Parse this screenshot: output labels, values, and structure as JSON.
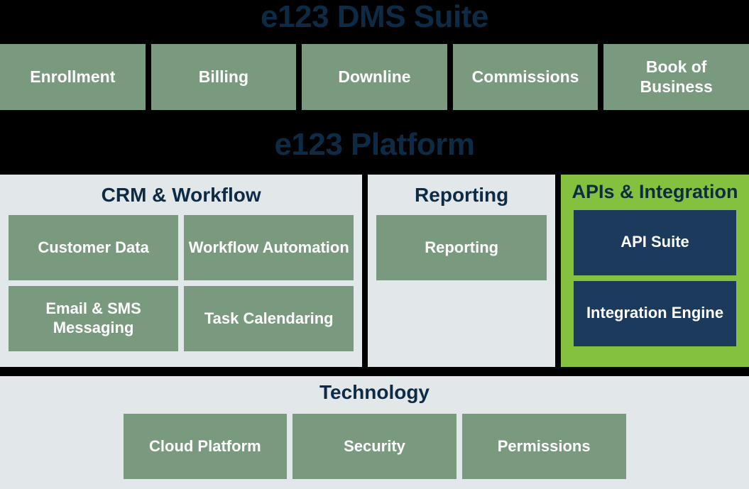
{
  "colors": {
    "background": "#000000",
    "green_tile": "#7a9a80",
    "panel_gray": "#e2e8e9",
    "accent_lime": "#84c13f",
    "navy_tile": "#1b3a5c",
    "title_navy": "#0d2b45",
    "tile_text": "#ffffff"
  },
  "suite": {
    "title": "e123 DMS Suite",
    "tiles": [
      {
        "label": "Enrollment"
      },
      {
        "label": "Billing"
      },
      {
        "label": "Downline"
      },
      {
        "label": "Commissions"
      },
      {
        "label": "Book of Business"
      }
    ]
  },
  "platform": {
    "title": "e123 Platform",
    "panels": [
      {
        "heading": "CRM & Workflow",
        "highlighted": false,
        "tiles": [
          {
            "label": "Customer Data"
          },
          {
            "label": "Workflow Automation"
          },
          {
            "label": "Email & SMS Messaging"
          },
          {
            "label": "Task Calendaring"
          }
        ]
      },
      {
        "heading": "Reporting",
        "highlighted": false,
        "tiles": [
          {
            "label": "Reporting"
          }
        ]
      },
      {
        "heading": "APIs & Integration",
        "highlighted": true,
        "tiles": [
          {
            "label": "API Suite"
          },
          {
            "label": "Integration Engine"
          }
        ]
      }
    ]
  },
  "technology": {
    "heading": "Technology",
    "tiles": [
      {
        "label": "Cloud Platform"
      },
      {
        "label": "Security"
      },
      {
        "label": "Permissions"
      }
    ]
  }
}
